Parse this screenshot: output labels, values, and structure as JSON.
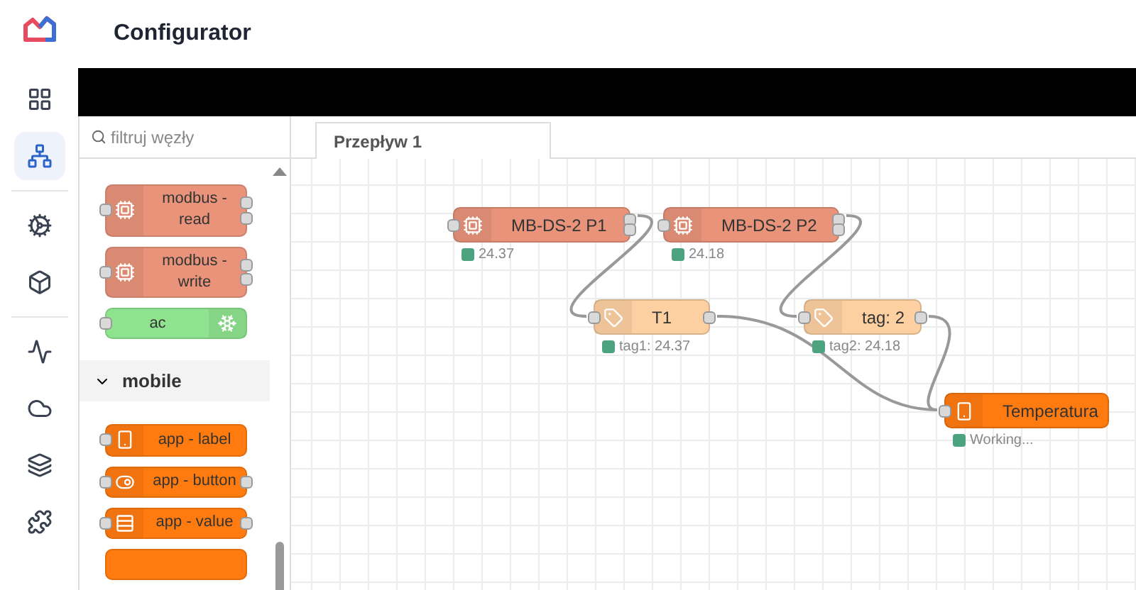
{
  "app": {
    "title": "Configurator"
  },
  "nav": [
    {
      "kind": "grid",
      "selected": false
    },
    {
      "kind": "network",
      "selected": true
    },
    {
      "kind": "gear",
      "selected": false
    },
    {
      "kind": "cube",
      "selected": false
    },
    {
      "kind": "pulse",
      "selected": false
    },
    {
      "kind": "cloud",
      "selected": false
    },
    {
      "kind": "layers",
      "selected": false
    },
    {
      "kind": "puzzle",
      "selected": false
    }
  ],
  "palette": {
    "search": {
      "placeholder": "filtruj węzły"
    },
    "items": [
      {
        "label": "modbus - read",
        "kind": "modbus"
      },
      {
        "label": "modbus - write",
        "kind": "modbus"
      },
      {
        "label": "ac",
        "kind": "ac"
      }
    ],
    "categories": [
      {
        "label": "mobile",
        "expanded": true,
        "items": [
          {
            "label": "app - label",
            "kind": "app-label"
          },
          {
            "label": "app - button",
            "kind": "app-button"
          },
          {
            "label": "app - value",
            "kind": "app-value"
          },
          {
            "kind": "app-more"
          }
        ]
      }
    ]
  },
  "tabs": [
    {
      "label": "Przepływ 1",
      "selected": true
    }
  ],
  "flow": {
    "nodes": [
      {
        "label": "MB-DS-2 P1",
        "kind": "modbus",
        "status": {
          "text": "24.37",
          "color": "#4da37f"
        }
      },
      {
        "label": "MB-DS-2 P2",
        "kind": "modbus",
        "status": {
          "text": "24.18",
          "color": "#4da37f"
        }
      },
      {
        "label": "T1",
        "kind": "tag",
        "status": {
          "text": "tag1: 24.37",
          "color": "#4da37f"
        }
      },
      {
        "label": "tag: 2",
        "kind": "tag",
        "status": {
          "text": "tag2: 24.18",
          "color": "#4da37f"
        }
      },
      {
        "label": "Temperatura",
        "kind": "app-label",
        "status": {
          "text": "Working...",
          "color": "#4da37f"
        }
      }
    ]
  }
}
